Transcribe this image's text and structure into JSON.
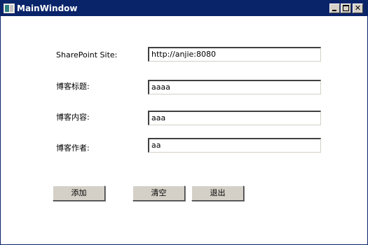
{
  "window": {
    "title": "MainWindow"
  },
  "title_buttons": {
    "minimize": "minimize-icon",
    "maximize": "maximize-icon",
    "close": "close-icon"
  },
  "form": {
    "site_label": "SharePoint Site:",
    "site_value": "http://anjie:8080",
    "title_label": "博客标题:",
    "title_value": "aaaa",
    "content_label": "博客内容:",
    "content_value": "aaa",
    "author_label": "博客作者:",
    "author_value": "aa"
  },
  "buttons": {
    "add": "添加",
    "clear": "清空",
    "exit": "退出"
  },
  "colors": {
    "titlebar": "#0a246a",
    "button_face": "#d4d0c8"
  }
}
